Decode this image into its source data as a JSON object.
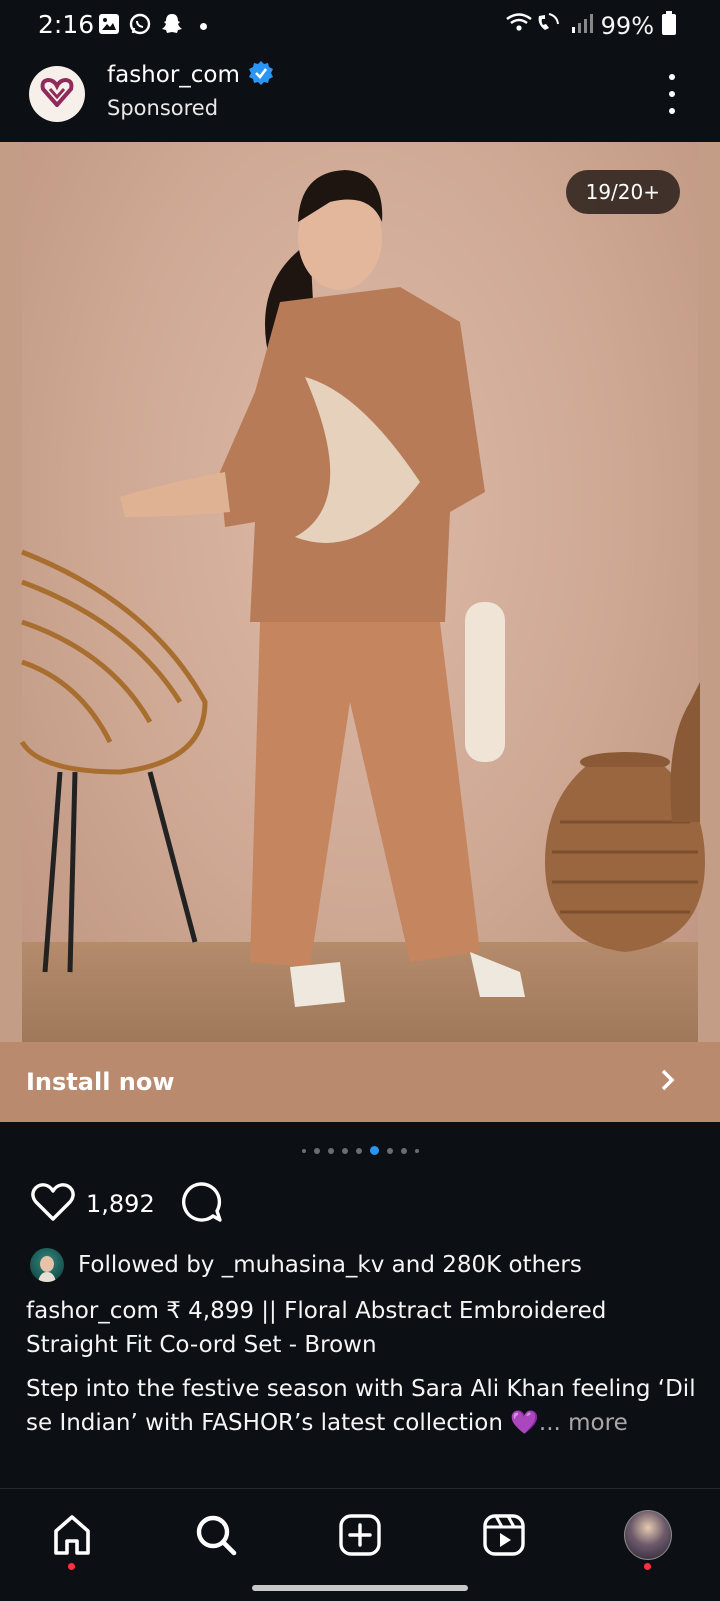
{
  "status_bar": {
    "time": "2:16",
    "battery": "99%"
  },
  "header": {
    "username": "fashor_com",
    "subtitle": "Sponsored"
  },
  "media": {
    "counter": "19/20+",
    "cta_label": "Install now",
    "carousel_dot_count": 9,
    "carousel_active_index": 5
  },
  "actions": {
    "like_count": "1,892"
  },
  "social": {
    "followed_text": "Followed by _muhasina_kv and 280K others"
  },
  "caption": {
    "title": "fashor_com ₹ 4,899 || Floral Abstract Embroidered Straight Fit Co-ord Set - Brown",
    "body": "Step into the festive season with Sara Ali Khan feeling ‘Dil se Indian’ with FASHOR’s latest collection 💜",
    "more_label": "... more"
  },
  "colors": {
    "background": "#0c1014",
    "verified_badge": "#2b95f6",
    "install_bar": "#b98a6d",
    "active_dot": "#2b95f6",
    "notification_dot": "#ff3040"
  },
  "icons": [
    "image-icon",
    "whatsapp-icon",
    "snapchat-icon",
    "wifi-call-icon",
    "signal-icon",
    "battery-icon",
    "verified-badge-icon",
    "more-vertical-icon",
    "chevron-right-icon",
    "heart-icon",
    "comment-icon",
    "home-icon",
    "search-icon",
    "create-icon",
    "reels-icon"
  ]
}
